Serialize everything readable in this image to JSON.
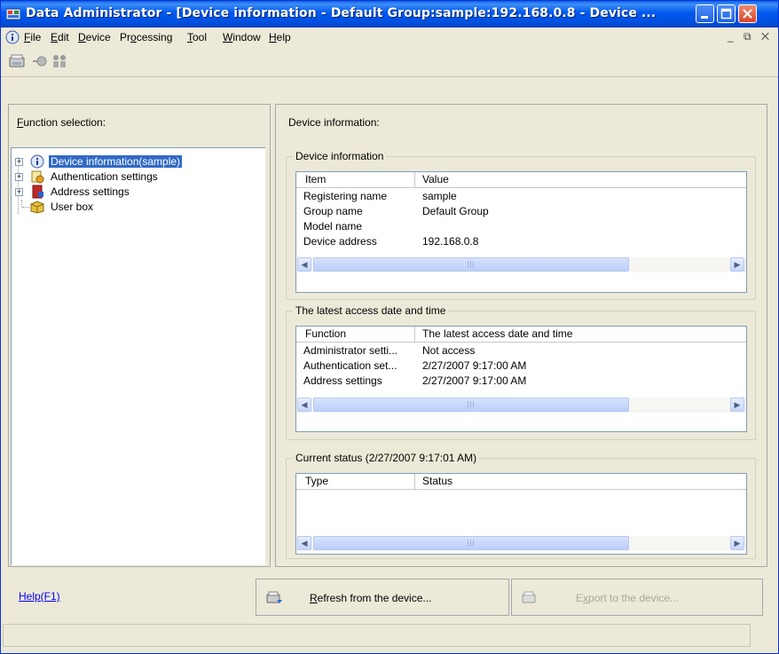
{
  "window": {
    "title": "Data Administrator - [Device information - Default Group:sample:192.168.0.8 - Device ...",
    "minimize_icon": "minimize-icon",
    "maximize_icon": "maximize-icon",
    "close_icon": "close-icon"
  },
  "menu": {
    "items": [
      {
        "label": "File",
        "accel": "F"
      },
      {
        "label": "Edit",
        "accel": "E"
      },
      {
        "label": "Device",
        "accel": "D"
      },
      {
        "label": "Processing",
        "accel": "o"
      },
      {
        "label": "Tool",
        "accel": "T"
      },
      {
        "label": "Window",
        "accel": "W"
      },
      {
        "label": "Help",
        "accel": "H"
      }
    ],
    "mdi_controls": "_ ⧉ ✕"
  },
  "left_pane": {
    "label": "Function selection:",
    "tree": [
      {
        "label": "Device information(sample)",
        "icon": "info-icon",
        "expander": "+",
        "selected": true
      },
      {
        "label": "Authentication settings",
        "icon": "auth-icon",
        "expander": "+"
      },
      {
        "label": "Address settings",
        "icon": "address-book-icon",
        "expander": "+"
      },
      {
        "label": "User box",
        "icon": "box-icon"
      }
    ]
  },
  "right_pane": {
    "title": "Device information:",
    "device_info": {
      "group_title": "Device information",
      "columns": [
        "Item",
        "Value"
      ],
      "rows": [
        [
          "Registering name",
          "sample"
        ],
        [
          "Group name",
          "Default Group"
        ],
        [
          "Model name",
          ""
        ],
        [
          "Device address",
          "192.168.0.8"
        ]
      ]
    },
    "latest_access": {
      "group_title": "The latest access date and time",
      "columns": [
        "Function",
        "The latest access date and time"
      ],
      "rows": [
        [
          "Administrator setti...",
          "Not access"
        ],
        [
          "Authentication set...",
          "2/27/2007 9:17:00 AM"
        ],
        [
          "Address settings",
          "2/27/2007 9:17:00 AM"
        ]
      ]
    },
    "current_status": {
      "group_title": "Current status (2/27/2007 9:17:01 AM)",
      "columns": [
        "Type",
        "Status"
      ],
      "rows": []
    }
  },
  "bottom": {
    "help_label": "Help(F1)",
    "refresh_label": "Refresh from the device...",
    "refresh_accel": "R",
    "export_label": "Export to the device...",
    "export_accel": "x"
  },
  "colors": {
    "titlebar": "#0058ee",
    "selection": "#316ac5",
    "link": "#0000ff"
  }
}
